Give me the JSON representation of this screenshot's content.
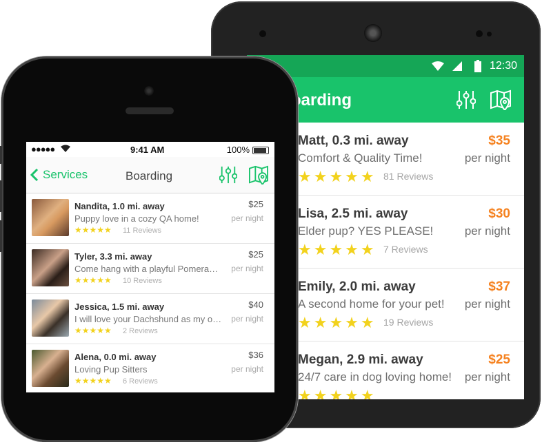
{
  "android": {
    "status": {
      "time": "12:30"
    },
    "appbar": {
      "title": "oarding"
    },
    "listings": [
      {
        "name": "Matt, 0.3 mi. away",
        "desc": "Comfort & Quality Time!",
        "stars": "★★★★★",
        "reviews": "81 Reviews",
        "price": "$35",
        "per": "per night"
      },
      {
        "name": "Lisa, 2.5 mi. away",
        "desc": "Elder pup? YES PLEASE!",
        "stars": "★★★★★",
        "reviews": "7 Reviews",
        "price": "$30",
        "per": "per night"
      },
      {
        "name": "Emily, 2.0 mi. away",
        "desc": "A second home for your pet!",
        "stars": "★★★★★",
        "reviews": "19 Reviews",
        "price": "$37",
        "per": "per night"
      },
      {
        "name": "Megan, 2.9 mi. away",
        "desc": "24/7 care in dog loving home!",
        "stars": "★★★★★",
        "reviews": "",
        "price": "$25",
        "per": "per night"
      }
    ]
  },
  "iphone": {
    "status": {
      "signal": "●●●●●",
      "time": "9:41 AM",
      "battery": "100%"
    },
    "nav": {
      "back_label": "Services",
      "title": "Boarding"
    },
    "listings": [
      {
        "name": "Nandita, 1.0 mi. away",
        "desc": "Puppy love in a cozy QA home!",
        "stars": "★★★★★",
        "reviews": "11 Reviews",
        "price": "$25",
        "per": "per night"
      },
      {
        "name": "Tyler, 3.3 mi. away",
        "desc": "Come hang with a playful Pomeranian!",
        "stars": "★★★★★",
        "reviews": "10 Reviews",
        "price": "$25",
        "per": "per night"
      },
      {
        "name": "Jessica, 1.5 mi. away",
        "desc": "I will love your Dachshund as my own!",
        "stars": "★★★★★",
        "reviews": "2 Reviews",
        "price": "$40",
        "per": "per night"
      },
      {
        "name": "Alena, 0.0 mi. away",
        "desc": "Loving Pup Sitters",
        "stars": "★★★★★",
        "reviews": "6 Reviews",
        "price": "$36",
        "per": "per night"
      }
    ]
  },
  "colors": {
    "green": "#19c36b",
    "dark_green": "#15a656",
    "orange": "#f58220",
    "star": "#f2d21d"
  },
  "icons": [
    "wifi-icon",
    "signal-icon",
    "battery-icon",
    "filter-sliders-icon",
    "map-pin-icon",
    "back-chevron-icon",
    "star-icon"
  ]
}
